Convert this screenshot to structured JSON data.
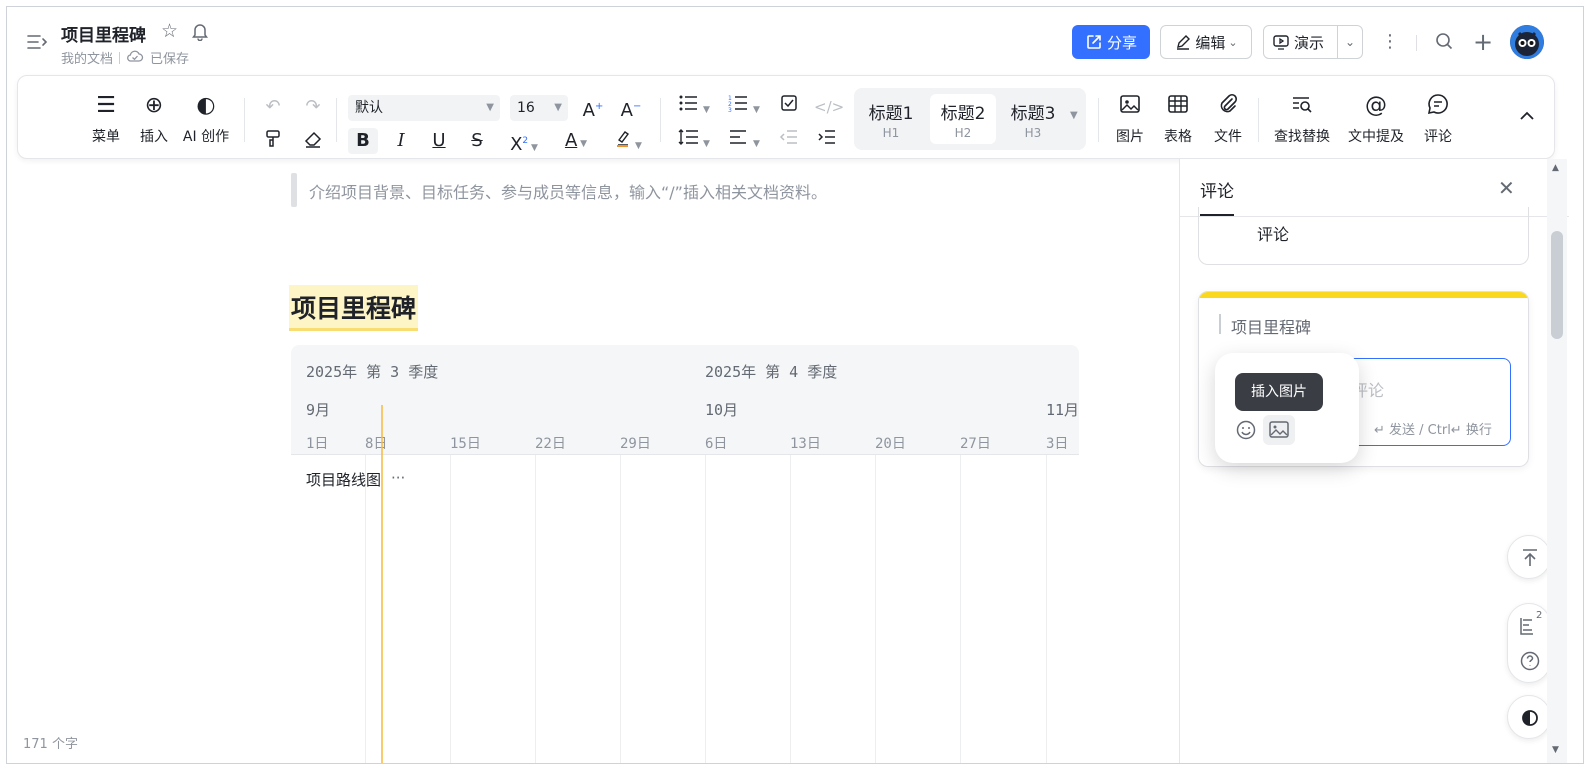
{
  "header": {
    "title": "项目里程碑",
    "location": "我的文档",
    "save_status": "已保存",
    "share_label": "分享",
    "edit_label": "编辑",
    "present_label": "演示"
  },
  "toolbar": {
    "menu_label": "菜单",
    "insert_label": "插入",
    "ai_label": "AI 创作",
    "font_family": "默认",
    "font_size": "16",
    "heading1": "标题1",
    "heading1_sub": "H1",
    "heading2": "标题2",
    "heading2_sub": "H2",
    "heading3": "标题3",
    "heading3_sub": "H3",
    "image_label": "图片",
    "table_label": "表格",
    "file_label": "文件",
    "find_label": "查找替换",
    "mention_label": "文中提及",
    "comment_label": "评论"
  },
  "editor": {
    "quote_text": "介绍项目背景、目标任务、参与成员等信息，输入“/”插入相关文档资料。",
    "heading": "项目里程碑",
    "word_count": "171 个字"
  },
  "gantt": {
    "quarters": [
      "2025年 第 3 季度",
      "2025年 第 4 季度"
    ],
    "months": [
      "9月",
      "10月",
      "11月"
    ],
    "days": [
      "1日",
      "8日",
      "15日",
      "22日",
      "29日",
      "6日",
      "13日",
      "20日",
      "27日",
      "3日"
    ],
    "row_label": "项目路线图",
    "row_more": "···"
  },
  "comments": {
    "panel_title": "评论",
    "card1_text": "评论",
    "card2_quote": "项目里程碑",
    "placeholder": "评论",
    "hint": "↵ 发送 / Ctrl↵ 换行",
    "tooltip": "插入图片"
  },
  "float": {
    "badge": "2"
  },
  "colors": {
    "accent": "#3370ff",
    "highlight": "#fad81d"
  }
}
